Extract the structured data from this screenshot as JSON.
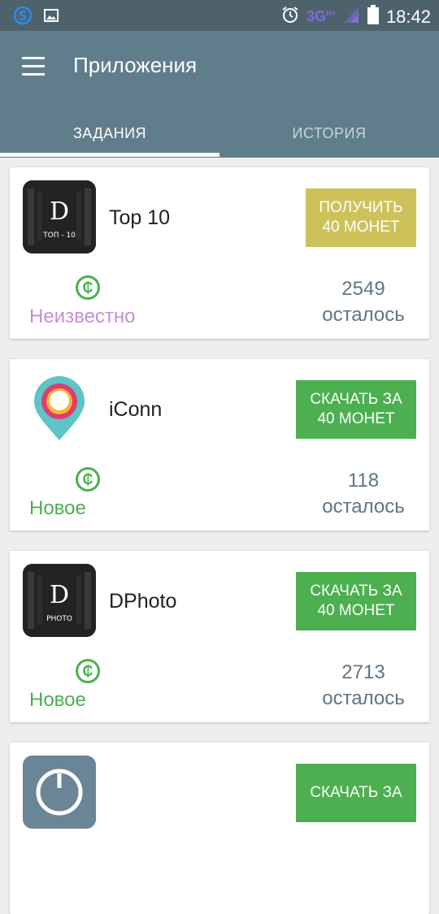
{
  "status_bar": {
    "time": "18:42",
    "network": "3G",
    "network_sup": "H+",
    "icons": [
      "sync-icon",
      "image-icon",
      "alarm-icon",
      "signal-icon",
      "battery-icon"
    ]
  },
  "app_bar": {
    "title": "Приложения",
    "menu_icon": "hamburger-menu-icon"
  },
  "tabs": [
    {
      "label": "ЗАДАНИЯ",
      "active": true
    },
    {
      "label": "ИСТОРИЯ",
      "active": false
    }
  ],
  "cards": [
    {
      "name": "Top 10",
      "icon": {
        "letter": "D",
        "caption": "ТОП - 10",
        "style": "dark"
      },
      "button_line1": "ПОЛУЧИТЬ",
      "button_line2": "40 МОНЕТ",
      "button_color": "#cdc25a",
      "status": "Неизвестно",
      "status_color": "#c58fd3",
      "coin_symbol": "₵",
      "count": "2549",
      "remaining": "осталось"
    },
    {
      "name": "iConn",
      "icon": {
        "style": "pin"
      },
      "button_line1": "СКАЧАТЬ ЗА",
      "button_line2": "40 МОНЕТ",
      "button_color": "#4caf50",
      "status": "Новое",
      "status_color": "#4caf50",
      "coin_symbol": "₵",
      "count": "118",
      "remaining": "осталось"
    },
    {
      "name": "DPhoto",
      "icon": {
        "letter": "D",
        "caption": "PHOTO",
        "style": "dark"
      },
      "button_line1": "СКАЧАТЬ ЗА",
      "button_line2": "40 МОНЕТ",
      "button_color": "#4caf50",
      "status": "Новое",
      "status_color": "#4caf50",
      "coin_symbol": "₵",
      "count": "2713",
      "remaining": "осталось"
    },
    {
      "name": "",
      "icon": {
        "style": "partial"
      },
      "button_line1": "СКАЧАТЬ ЗА",
      "button_line2": "",
      "button_color": "#4caf50"
    }
  ]
}
